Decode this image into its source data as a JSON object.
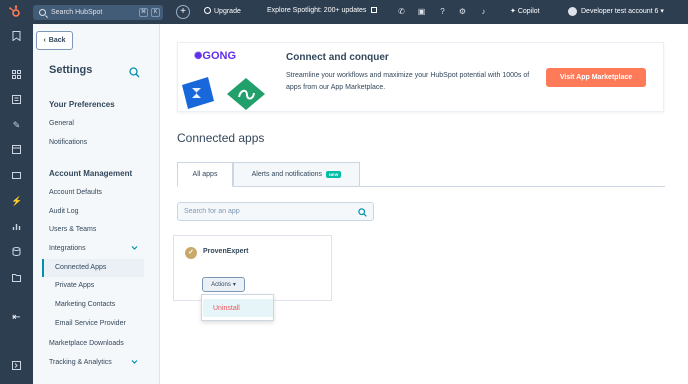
{
  "topbar": {
    "search_placeholder": "Search HubSpot",
    "kbd_1": "⌘",
    "kbd_2": "K",
    "upgrade": "Upgrade",
    "explore": "Explore Spotlight: 200+ updates",
    "copilot": "Copilot",
    "account": "Developer test account 6"
  },
  "sidebar": {
    "back": "Back",
    "title": "Settings",
    "your_preferences": "Your Preferences",
    "general": "General",
    "notifications": "Notifications",
    "account_management": "Account Management",
    "account_defaults": "Account Defaults",
    "audit_log": "Audit Log",
    "users_teams": "Users & Teams",
    "integrations": "Integrations",
    "connected_apps": "Connected Apps",
    "private_apps": "Private Apps",
    "marketing_contacts": "Marketing Contacts",
    "email_service_provider": "Email Service Provider",
    "marketplace_downloads": "Marketplace Downloads",
    "tracking_analytics": "Tracking & Analytics"
  },
  "banner": {
    "gong": "GONG",
    "title": "Connect and conquer",
    "text": "Streamline your workflows and maximize your HubSpot potential with 1000s of apps from our App Marketplace.",
    "button": "Visit App Marketplace"
  },
  "main": {
    "title": "Connected apps",
    "tab_all": "All apps",
    "tab_alerts": "Alerts and notifications",
    "new_badge": "NEW",
    "search_placeholder": "Search for an app"
  },
  "app_card": {
    "name": "ProvenExpert",
    "actions": "Actions",
    "menu_uninstall": "Uninstall"
  },
  "colors": {
    "nav_bg": "#2d3e50",
    "accent": "#ff7a59",
    "link": "#0091ae",
    "danger": "#f2545b"
  }
}
